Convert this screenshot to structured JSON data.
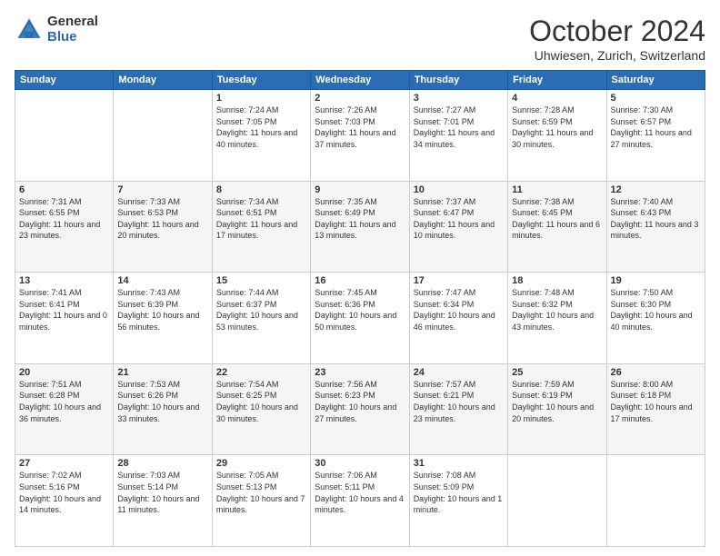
{
  "logo": {
    "general": "General",
    "blue": "Blue"
  },
  "title": "October 2024",
  "location": "Uhwiesen, Zurich, Switzerland",
  "days_header": [
    "Sunday",
    "Monday",
    "Tuesday",
    "Wednesday",
    "Thursday",
    "Friday",
    "Saturday"
  ],
  "weeks": [
    [
      {
        "num": "",
        "info": ""
      },
      {
        "num": "",
        "info": ""
      },
      {
        "num": "1",
        "info": "Sunrise: 7:24 AM\nSunset: 7:05 PM\nDaylight: 11 hours and 40 minutes."
      },
      {
        "num": "2",
        "info": "Sunrise: 7:26 AM\nSunset: 7:03 PM\nDaylight: 11 hours and 37 minutes."
      },
      {
        "num": "3",
        "info": "Sunrise: 7:27 AM\nSunset: 7:01 PM\nDaylight: 11 hours and 34 minutes."
      },
      {
        "num": "4",
        "info": "Sunrise: 7:28 AM\nSunset: 6:59 PM\nDaylight: 11 hours and 30 minutes."
      },
      {
        "num": "5",
        "info": "Sunrise: 7:30 AM\nSunset: 6:57 PM\nDaylight: 11 hours and 27 minutes."
      }
    ],
    [
      {
        "num": "6",
        "info": "Sunrise: 7:31 AM\nSunset: 6:55 PM\nDaylight: 11 hours and 23 minutes."
      },
      {
        "num": "7",
        "info": "Sunrise: 7:33 AM\nSunset: 6:53 PM\nDaylight: 11 hours and 20 minutes."
      },
      {
        "num": "8",
        "info": "Sunrise: 7:34 AM\nSunset: 6:51 PM\nDaylight: 11 hours and 17 minutes."
      },
      {
        "num": "9",
        "info": "Sunrise: 7:35 AM\nSunset: 6:49 PM\nDaylight: 11 hours and 13 minutes."
      },
      {
        "num": "10",
        "info": "Sunrise: 7:37 AM\nSunset: 6:47 PM\nDaylight: 11 hours and 10 minutes."
      },
      {
        "num": "11",
        "info": "Sunrise: 7:38 AM\nSunset: 6:45 PM\nDaylight: 11 hours and 6 minutes."
      },
      {
        "num": "12",
        "info": "Sunrise: 7:40 AM\nSunset: 6:43 PM\nDaylight: 11 hours and 3 minutes."
      }
    ],
    [
      {
        "num": "13",
        "info": "Sunrise: 7:41 AM\nSunset: 6:41 PM\nDaylight: 11 hours and 0 minutes."
      },
      {
        "num": "14",
        "info": "Sunrise: 7:43 AM\nSunset: 6:39 PM\nDaylight: 10 hours and 56 minutes."
      },
      {
        "num": "15",
        "info": "Sunrise: 7:44 AM\nSunset: 6:37 PM\nDaylight: 10 hours and 53 minutes."
      },
      {
        "num": "16",
        "info": "Sunrise: 7:45 AM\nSunset: 6:36 PM\nDaylight: 10 hours and 50 minutes."
      },
      {
        "num": "17",
        "info": "Sunrise: 7:47 AM\nSunset: 6:34 PM\nDaylight: 10 hours and 46 minutes."
      },
      {
        "num": "18",
        "info": "Sunrise: 7:48 AM\nSunset: 6:32 PM\nDaylight: 10 hours and 43 minutes."
      },
      {
        "num": "19",
        "info": "Sunrise: 7:50 AM\nSunset: 6:30 PM\nDaylight: 10 hours and 40 minutes."
      }
    ],
    [
      {
        "num": "20",
        "info": "Sunrise: 7:51 AM\nSunset: 6:28 PM\nDaylight: 10 hours and 36 minutes."
      },
      {
        "num": "21",
        "info": "Sunrise: 7:53 AM\nSunset: 6:26 PM\nDaylight: 10 hours and 33 minutes."
      },
      {
        "num": "22",
        "info": "Sunrise: 7:54 AM\nSunset: 6:25 PM\nDaylight: 10 hours and 30 minutes."
      },
      {
        "num": "23",
        "info": "Sunrise: 7:56 AM\nSunset: 6:23 PM\nDaylight: 10 hours and 27 minutes."
      },
      {
        "num": "24",
        "info": "Sunrise: 7:57 AM\nSunset: 6:21 PM\nDaylight: 10 hours and 23 minutes."
      },
      {
        "num": "25",
        "info": "Sunrise: 7:59 AM\nSunset: 6:19 PM\nDaylight: 10 hours and 20 minutes."
      },
      {
        "num": "26",
        "info": "Sunrise: 8:00 AM\nSunset: 6:18 PM\nDaylight: 10 hours and 17 minutes."
      }
    ],
    [
      {
        "num": "27",
        "info": "Sunrise: 7:02 AM\nSunset: 5:16 PM\nDaylight: 10 hours and 14 minutes."
      },
      {
        "num": "28",
        "info": "Sunrise: 7:03 AM\nSunset: 5:14 PM\nDaylight: 10 hours and 11 minutes."
      },
      {
        "num": "29",
        "info": "Sunrise: 7:05 AM\nSunset: 5:13 PM\nDaylight: 10 hours and 7 minutes."
      },
      {
        "num": "30",
        "info": "Sunrise: 7:06 AM\nSunset: 5:11 PM\nDaylight: 10 hours and 4 minutes."
      },
      {
        "num": "31",
        "info": "Sunrise: 7:08 AM\nSunset: 5:09 PM\nDaylight: 10 hours and 1 minute."
      },
      {
        "num": "",
        "info": ""
      },
      {
        "num": "",
        "info": ""
      }
    ]
  ]
}
